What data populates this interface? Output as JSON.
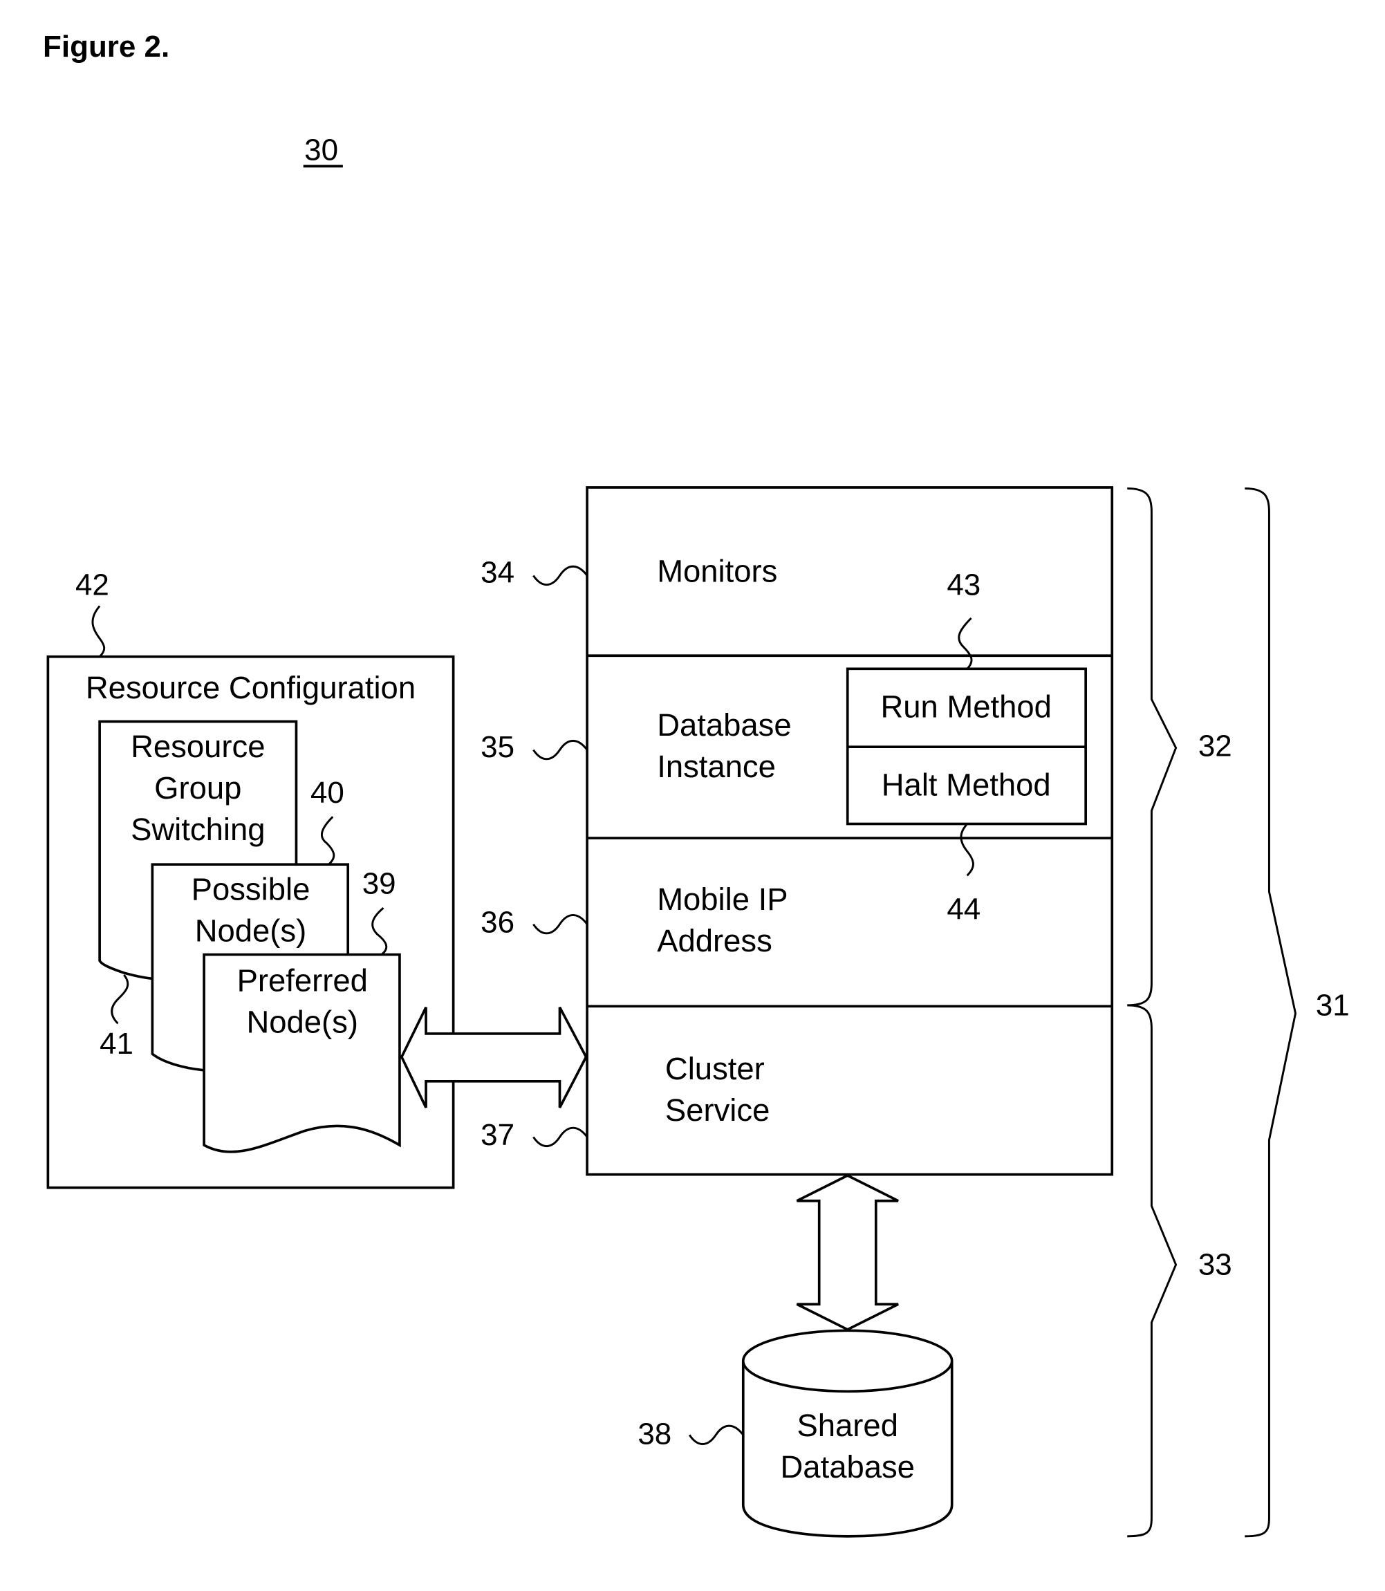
{
  "figure": {
    "title": "Figure 2.",
    "system_ref": "30"
  },
  "resource_configuration": {
    "ref": "42",
    "title": "Resource Configuration",
    "documents": [
      {
        "ref": "41",
        "lines": [
          "Resource",
          "Group",
          "Switching"
        ]
      },
      {
        "ref": "40",
        "lines": [
          "Possible",
          "Node(s)"
        ]
      },
      {
        "ref": "39",
        "lines": [
          "Preferred",
          "Node(s)"
        ]
      }
    ]
  },
  "stack": {
    "layers": [
      {
        "ref": "34",
        "lines": [
          "Monitors"
        ]
      },
      {
        "ref": "35",
        "lines": [
          "Database",
          "Instance"
        ]
      },
      {
        "ref": "36",
        "lines": [
          "Mobile IP",
          "Address"
        ]
      },
      {
        "ref": "37",
        "lines": [
          "Cluster",
          "Service"
        ]
      }
    ],
    "methods": [
      {
        "ref": "43",
        "label": "Run Method"
      },
      {
        "ref": "44",
        "label": "Halt Method"
      }
    ]
  },
  "shared_database": {
    "ref": "38",
    "lines": [
      "Shared",
      "Database"
    ]
  },
  "braces": [
    {
      "ref": "32",
      "spans": "Monitors through Mobile IP Address"
    },
    {
      "ref": "33",
      "spans": "Cluster Service through Shared Database"
    },
    {
      "ref": "31",
      "spans": "entire node"
    }
  ]
}
